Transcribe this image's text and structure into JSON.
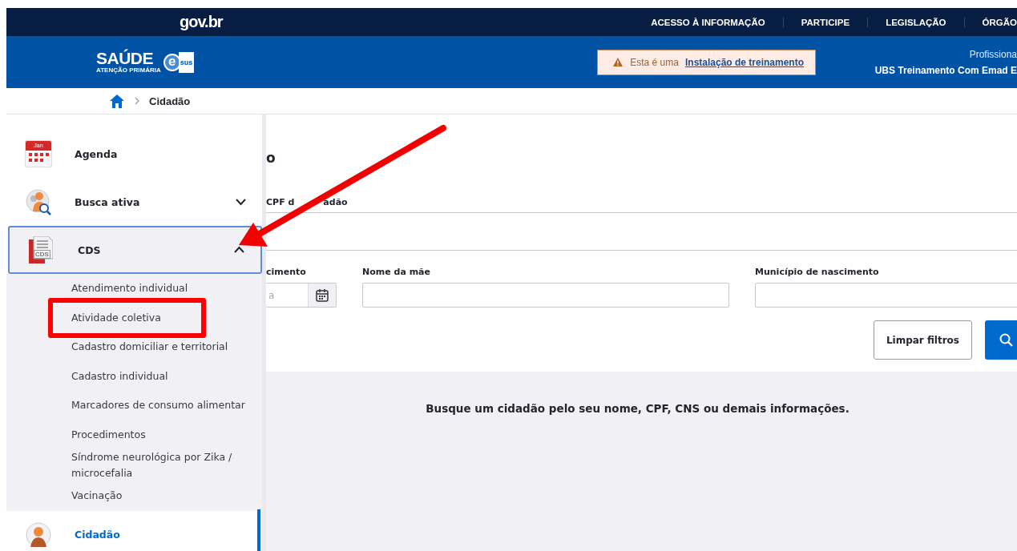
{
  "gov_bar": {
    "logo": "gov.br",
    "links": [
      "ACESSO À INFORMAÇÃO",
      "PARTICIPE",
      "LEGISLAÇÃO",
      "ÓRGÃO"
    ]
  },
  "header": {
    "logo": {
      "title": "SAÚDE",
      "badge": "e",
      "brand": "sus",
      "subtitle": "ATENÇÃO PRIMÁRIA"
    },
    "notice": {
      "text": "Esta é uma",
      "link": "Instalação de treinamento"
    },
    "user": {
      "role": "Profissiona",
      "unit": "UBS Treinamento Com Emad E"
    }
  },
  "breadcrumb": {
    "current": "Cidadão"
  },
  "sidebar": {
    "items": [
      {
        "label": "Agenda",
        "kind": "calendar",
        "icon_text": "Jan",
        "selected": false
      },
      {
        "label": "Busca ativa",
        "kind": "search",
        "selected": false,
        "expanded": false
      },
      {
        "label": "CDS",
        "kind": "document",
        "icon_text": "CDS",
        "selected": false,
        "expanded": true,
        "children": [
          {
            "label": "Atendimento individual",
            "highlighted": false
          },
          {
            "label": "Atividade coletiva",
            "highlighted": true
          },
          {
            "label": "Cadastro domiciliar e territorial",
            "highlighted": false
          },
          {
            "label": "Cadastro individual",
            "highlighted": false
          },
          {
            "label": "Marcadores de consumo alimentar",
            "highlighted": false
          },
          {
            "label": "Procedimentos",
            "highlighted": false
          },
          {
            "label": "Síndrome neurológica por Zika / microcefalia",
            "highlighted": false
          },
          {
            "label": "Vacinação",
            "highlighted": false
          }
        ]
      },
      {
        "label": "Cidadão",
        "kind": "person",
        "selected": true
      }
    ]
  },
  "main": {
    "title": "o",
    "search_label": [
      "CPF d",
      "adão"
    ],
    "filters": [
      {
        "kind": "date",
        "label": "cimento",
        "placeholder": "a"
      },
      {
        "kind": "text",
        "label": "Nome da mãe"
      },
      {
        "kind": "text",
        "label": "Município de nascimento"
      }
    ],
    "clear_button": "Limpar filtros",
    "empty_message": "Busque um cidadão pelo seu nome, CPF, CNS ou demais informações."
  },
  "annotations": [
    {
      "kind": "arrow"
    }
  ]
}
